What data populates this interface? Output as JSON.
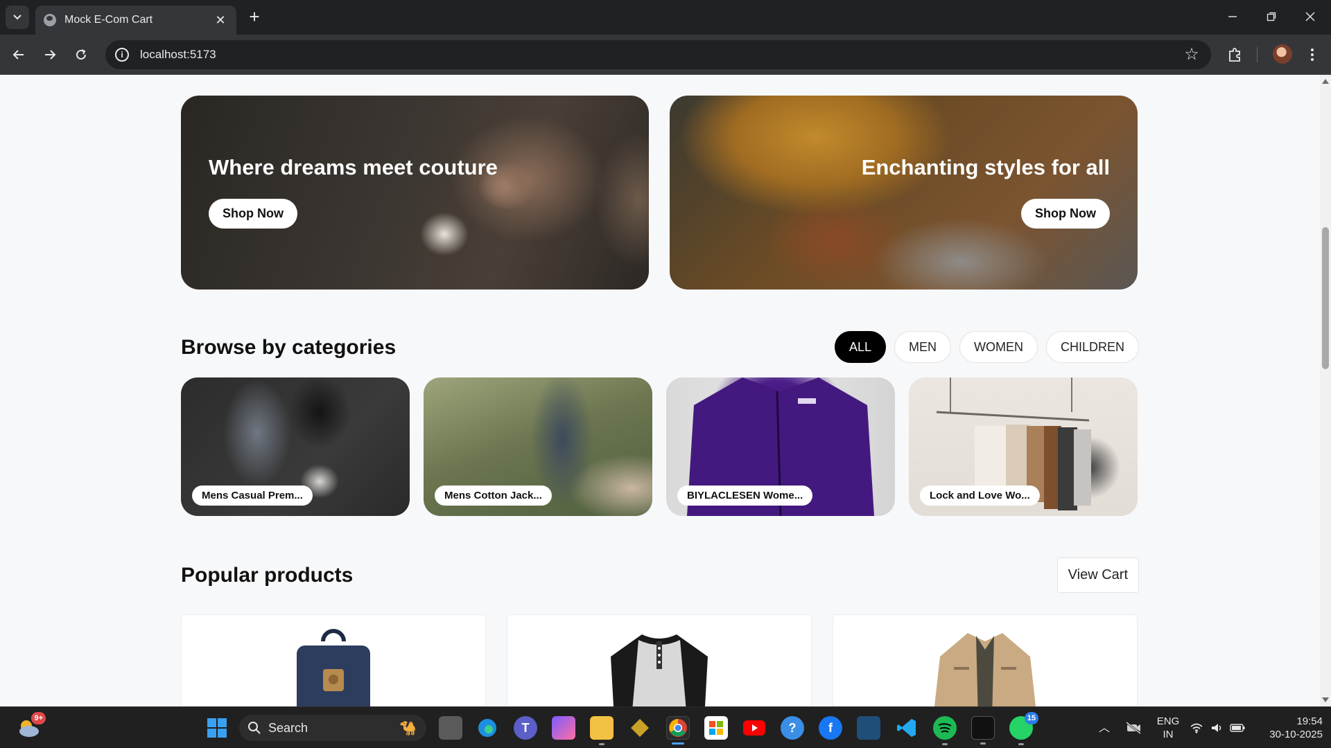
{
  "browser": {
    "tab_title": "Mock E-Com Cart",
    "new_tab": "+",
    "url": "localhost:5173"
  },
  "hero_banners": [
    {
      "title": "Where dreams meet couture",
      "button": "Shop Now"
    },
    {
      "title": "Enchanting styles for all",
      "button": "Shop Now"
    }
  ],
  "categories_section": {
    "title": "Browse by categories",
    "filters": [
      {
        "label": "ALL",
        "active": true
      },
      {
        "label": "MEN",
        "active": false
      },
      {
        "label": "WOMEN",
        "active": false
      },
      {
        "label": "CHILDREN",
        "active": false
      }
    ],
    "cards": [
      {
        "label": "Mens Casual Prem..."
      },
      {
        "label": "Mens Cotton Jack..."
      },
      {
        "label": "BIYLACLESEN Wome..."
      },
      {
        "label": "Lock and Love Wo..."
      }
    ]
  },
  "popular_section": {
    "title": "Popular products",
    "view_cart": "View Cart",
    "products": [
      {
        "image": "backpack"
      },
      {
        "image": "raglan-shirt"
      },
      {
        "image": "cotton-jacket"
      }
    ]
  },
  "taskbar": {
    "search_placeholder": "Search",
    "weather_badge": "9+",
    "whatsapp_badge": "15",
    "language": "ENG",
    "region": "IN",
    "time": "19:54",
    "date": "30-10-2025"
  },
  "colors": {
    "page_bg": "#f7f8fa",
    "chrome_dark": "#202124",
    "chrome_toolbar": "#35363a",
    "active_chip": "#000000"
  }
}
